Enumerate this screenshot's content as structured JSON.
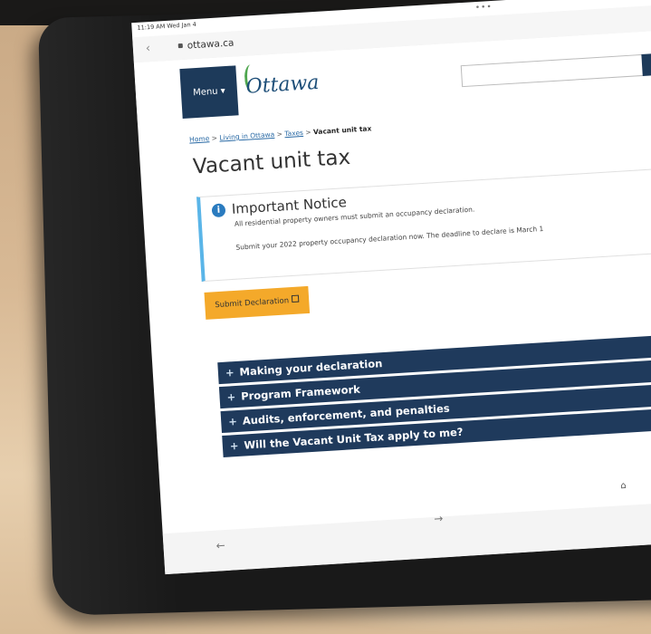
{
  "status_bar": {
    "time": "11:19 AM  Wed Jan 4",
    "multitask_dots": "•••"
  },
  "browser": {
    "url": "ottawa.ca",
    "back_icon": "chevron-left-icon",
    "lock_icon": "lock-icon",
    "forward_arrow": "→",
    "back_arrow": "←",
    "home_icon": "⌂"
  },
  "header": {
    "menu_label": "Menu ▾",
    "logo_text": "Ottawa",
    "search_placeholder": "",
    "search_button_icon": "Q"
  },
  "breadcrumb": {
    "items": [
      "Home",
      "Living in Ottawa",
      "Taxes"
    ],
    "separator": ">",
    "current": "Vacant unit tax"
  },
  "page": {
    "title": "Vacant unit tax",
    "notice_icon": "i",
    "notice_title": "Important Notice",
    "notice_line1": "All residential property owners must submit an occupancy declaration.",
    "notice_line2": "Submit your 2022 property occupancy declaration now. The deadline to declare is March 1",
    "submit_label": "Submit Declaration",
    "side_button_label": "E"
  },
  "accordion": [
    {
      "label": "Making your declaration"
    },
    {
      "label": "Program Framework"
    },
    {
      "label": "Audits, enforcement, and penalties"
    },
    {
      "label": "Will the Vacant Unit Tax apply to me?"
    }
  ],
  "colors": {
    "navy": "#1f3a5c",
    "accent_yellow": "#f4a92a",
    "notice_border": "#5ab5e8",
    "link": "#2a6aa5"
  }
}
